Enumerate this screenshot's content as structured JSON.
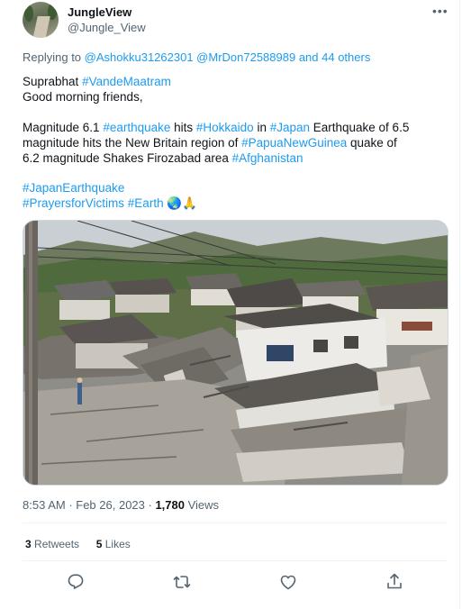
{
  "author": {
    "name": "JungleView",
    "handle": "@Jungle_View"
  },
  "reply": {
    "prefix": "Replying to ",
    "mentions": "@Ashokku31262301 @MrDon72588989",
    "suffix": " and 44 others"
  },
  "tweet": {
    "l1a": "Suprabhat ",
    "l1b": "#VandeMaatram",
    "l2": "Good morning friends,",
    "l3a": "Magnitude 6.1 ",
    "l3b": "#earthquake",
    "l3c": " hits ",
    "l3d": "#Hokkaido",
    "l3e": " in ",
    "l3f": "#Japan",
    "l3g": " Earthquake of 6.5",
    "l4a": "magnitude hits the New Britain region of ",
    "l4b": "#PapuaNewGuinea",
    "l4c": " quake of",
    "l5a": "6.2 magnitude Shakes Firozabad area ",
    "l5b": "#Afghanistan",
    "l6": "#JapanEarthquake",
    "l7a": "#PrayersforVictims",
    "l7b": " ",
    "l7c": "#Earth",
    "l7d": " 🌏🙏"
  },
  "meta": {
    "time": "8:53 AM",
    "sep": " · ",
    "date": "Feb 26, 2023",
    "sep2": " · ",
    "views_count": "1,780",
    "views_label": " Views"
  },
  "stats": {
    "retweets_count": "3",
    "retweets_label": " Retweets",
    "likes_count": "5",
    "likes_label": " Likes"
  },
  "icons": [
    "reply-icon",
    "retweet-icon",
    "like-icon",
    "share-icon",
    "more-icon"
  ],
  "colors": {
    "link": "#1d9bf0",
    "secondary": "#536471",
    "text": "#0f1419"
  }
}
